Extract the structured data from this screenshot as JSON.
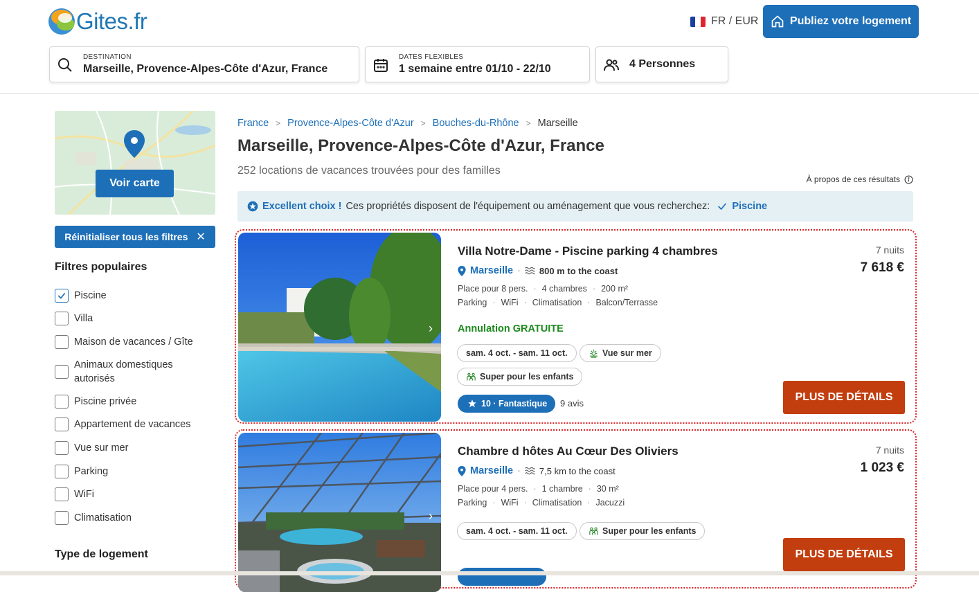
{
  "header": {
    "logo_text": "Gites.fr",
    "lang_currency": "FR / EUR",
    "publish_label": "Publiez votre logement"
  },
  "search": {
    "destination_caption": "DESTINATION",
    "destination_value": "Marseille, Provence-Alpes-Côte d'Azur, France",
    "dates_caption": "DATES FLEXIBLES",
    "dates_value": "1 semaine entre 01/10 - 22/10",
    "guests_value": "4 Personnes"
  },
  "sidebar": {
    "map_button": "Voir carte",
    "reset_label": "Réinitialiser tous les filtres",
    "popular_title": "Filtres populaires",
    "filters": [
      {
        "label": "Piscine",
        "checked": true
      },
      {
        "label": "Villa",
        "checked": false
      },
      {
        "label": "Maison de vacances / Gîte",
        "checked": false
      },
      {
        "label": "Animaux domestiques autorisés",
        "checked": false
      },
      {
        "label": "Piscine privée",
        "checked": false
      },
      {
        "label": "Appartement de vacances",
        "checked": false
      },
      {
        "label": "Vue sur mer",
        "checked": false
      },
      {
        "label": "Parking",
        "checked": false
      },
      {
        "label": "WiFi",
        "checked": false
      },
      {
        "label": "Climatisation",
        "checked": false
      }
    ],
    "type_title": "Type de logement"
  },
  "main": {
    "breadcrumb": [
      "France",
      "Provence-Alpes-Côte d'Azur",
      "Bouches-du-Rhône",
      "Marseille"
    ],
    "title": "Marseille, Provence-Alpes-Côte d'Azur, France",
    "subtitle": "252 locations de vacances trouvées pour des familles",
    "about": "À propos de ces résultats",
    "banner": {
      "strong": "Excellent choix !",
      "text": "Ces propriétés disposent de l'équipement ou aménagement que vous recherchez:",
      "feature": "Piscine"
    }
  },
  "listings": [
    {
      "title": "Villa Notre-Dame - Piscine parking 4 chambres",
      "nights": "7 nuits",
      "price": "7 618 €",
      "city": "Marseille",
      "coast": "800 m to the coast",
      "meta1": [
        "Place pour 8 pers.",
        "4 chambres",
        "200 m²"
      ],
      "meta2": [
        "Parking",
        "WiFi",
        "Climatisation",
        "Balcon/Terrasse"
      ],
      "cancel": "Annulation GRATUITE",
      "dates": "sam. 4 oct. - sam. 11 oct.",
      "tag1": "Vue sur mer",
      "tag2": "Super pour les enfants",
      "rating": "10 · Fantastique",
      "reviews": "9 avis",
      "cta": "PLUS DE DÉTAILS"
    },
    {
      "title": "Chambre d hôtes Au Cœur Des Oliviers",
      "nights": "7 nuits",
      "price": "1 023 €",
      "city": "Marseille",
      "coast": "7,5 km to the coast",
      "meta1": [
        "Place pour 4 pers.",
        "1 chambre",
        "30 m²"
      ],
      "meta2": [
        "Parking",
        "WiFi",
        "Climatisation",
        "Jacuzzi"
      ],
      "dates": "sam. 4 oct. - sam. 11 oct.",
      "tag1": "Super pour les enfants",
      "cta": "PLUS DE DÉTAILS"
    }
  ],
  "colors": {
    "brand_blue": "#1d6fb8",
    "cta_orange": "#c23e0f",
    "cancel_green": "#1c8a1c",
    "card_border": "#d8262a",
    "banner_bg": "#e5f0f4"
  },
  "icons": [
    "search-icon",
    "calendar-icon",
    "people-icon",
    "home-icon",
    "map-pin-icon",
    "star-icon",
    "check-icon",
    "info-icon",
    "close-icon",
    "waves-icon",
    "sunrise-icon",
    "family-icon",
    "chevron-right-icon"
  ]
}
